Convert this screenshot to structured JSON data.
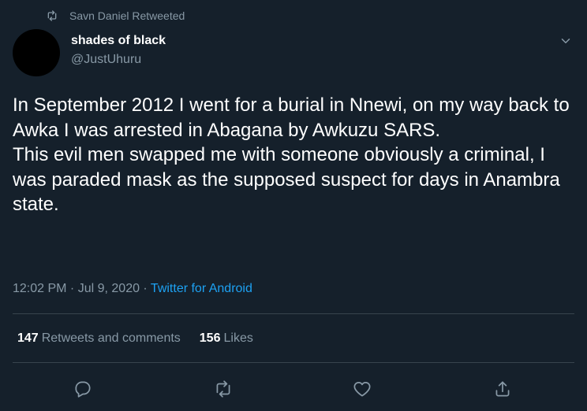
{
  "retweet_header": {
    "text": "Savn Daniel Retweeted",
    "icon": "retweet-icon"
  },
  "author": {
    "name": "shades of black",
    "handle": "@JustUhuru"
  },
  "tweet": {
    "text": "In September 2012 I went for a burial in Nnewi, on my way back to Awka I was arrested in Abagana by Awkuzu SARS.\nThis evil men swapped me with someone obviously a criminal, I was paraded mask as the supposed suspect for days in Anambra state.",
    "time": "12:02 PM",
    "separator1": " · ",
    "date": "Jul 9, 2020",
    "separator2": " · ",
    "source": "Twitter for Android"
  },
  "stats": {
    "retweets_count": "147",
    "retweets_label": "Retweets and comments",
    "likes_count": "156",
    "likes_label": "Likes"
  },
  "actions": [
    "reply-icon",
    "retweet-icon",
    "like-icon",
    "share-icon"
  ],
  "colors": {
    "background": "#15202b",
    "secondary_text": "#8899a6",
    "accent": "#1da1f2",
    "divider": "#38444d"
  }
}
